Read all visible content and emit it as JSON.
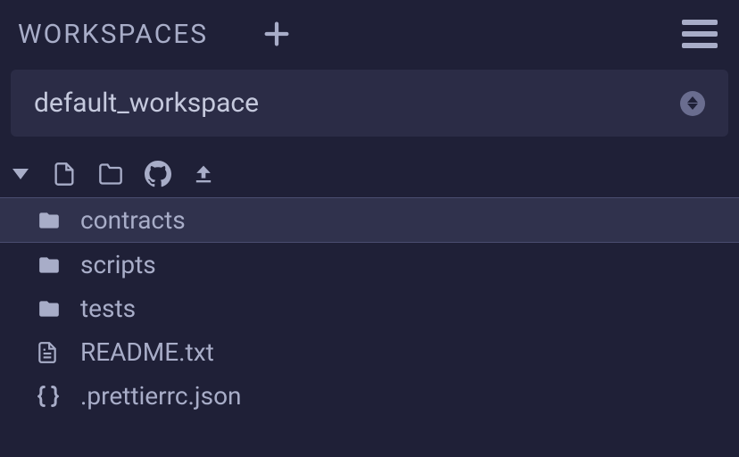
{
  "header": {
    "title": "WORKSPACES"
  },
  "workspace_selector": {
    "selected": "default_workspace"
  },
  "tree": {
    "items": [
      {
        "name": "contracts",
        "type": "folder",
        "selected": true
      },
      {
        "name": "scripts",
        "type": "folder",
        "selected": false
      },
      {
        "name": "tests",
        "type": "folder",
        "selected": false
      },
      {
        "name": "README.txt",
        "type": "file-text",
        "selected": false
      },
      {
        "name": ".prettierrc.json",
        "type": "file-json",
        "selected": false
      }
    ]
  }
}
